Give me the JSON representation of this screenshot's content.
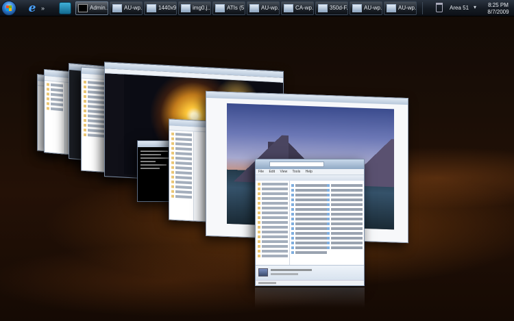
{
  "taskbar": {
    "tasks": [
      {
        "label": "Admin..."
      },
      {
        "label": "AU-wp..."
      },
      {
        "label": "1440x9..."
      },
      {
        "label": "img0.j..."
      },
      {
        "label": "ATIs (5..."
      },
      {
        "label": "AU-wp..."
      },
      {
        "label": "CA-wp..."
      },
      {
        "label": "350d-F..."
      },
      {
        "label": "AU-wp..."
      },
      {
        "label": "AU-wp..."
      }
    ],
    "language": "Area 51",
    "clock": {
      "time": "8:25 PM",
      "date": "8/7/2009"
    }
  },
  "front_window": {
    "menu": [
      "File",
      "Edit",
      "View",
      "Tools",
      "Help"
    ]
  },
  "colors": {
    "taskbar_top": "#2b3440",
    "taskbar_bottom": "#0c1016",
    "background_glow": "#aa5a14"
  },
  "icons": [
    "start-orb-icon",
    "internet-explorer-icon",
    "switch-windows-icon",
    "recycle-bin-icon"
  ]
}
